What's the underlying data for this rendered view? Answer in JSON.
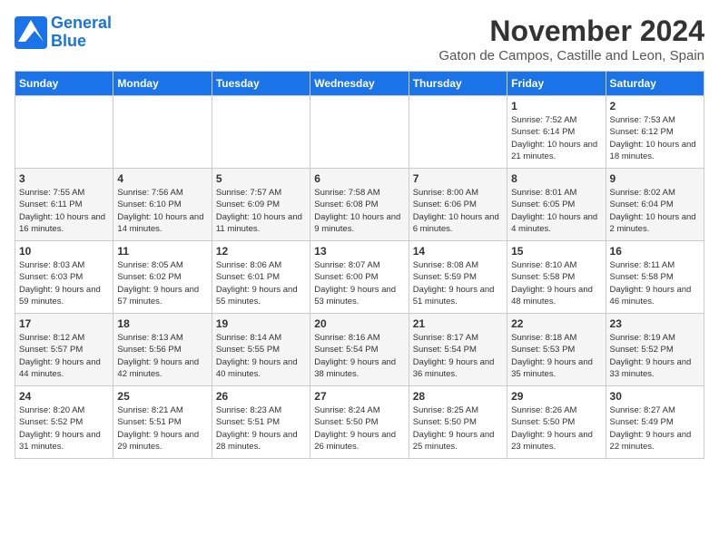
{
  "logo": {
    "line1": "General",
    "line2": "Blue"
  },
  "title": "November 2024",
  "location": "Gaton de Campos, Castille and Leon, Spain",
  "days_of_week": [
    "Sunday",
    "Monday",
    "Tuesday",
    "Wednesday",
    "Thursday",
    "Friday",
    "Saturday"
  ],
  "weeks": [
    [
      {
        "day": "",
        "info": ""
      },
      {
        "day": "",
        "info": ""
      },
      {
        "day": "",
        "info": ""
      },
      {
        "day": "",
        "info": ""
      },
      {
        "day": "",
        "info": ""
      },
      {
        "day": "1",
        "info": "Sunrise: 7:52 AM\nSunset: 6:14 PM\nDaylight: 10 hours and 21 minutes."
      },
      {
        "day": "2",
        "info": "Sunrise: 7:53 AM\nSunset: 6:12 PM\nDaylight: 10 hours and 18 minutes."
      }
    ],
    [
      {
        "day": "3",
        "info": "Sunrise: 7:55 AM\nSunset: 6:11 PM\nDaylight: 10 hours and 16 minutes."
      },
      {
        "day": "4",
        "info": "Sunrise: 7:56 AM\nSunset: 6:10 PM\nDaylight: 10 hours and 14 minutes."
      },
      {
        "day": "5",
        "info": "Sunrise: 7:57 AM\nSunset: 6:09 PM\nDaylight: 10 hours and 11 minutes."
      },
      {
        "day": "6",
        "info": "Sunrise: 7:58 AM\nSunset: 6:08 PM\nDaylight: 10 hours and 9 minutes."
      },
      {
        "day": "7",
        "info": "Sunrise: 8:00 AM\nSunset: 6:06 PM\nDaylight: 10 hours and 6 minutes."
      },
      {
        "day": "8",
        "info": "Sunrise: 8:01 AM\nSunset: 6:05 PM\nDaylight: 10 hours and 4 minutes."
      },
      {
        "day": "9",
        "info": "Sunrise: 8:02 AM\nSunset: 6:04 PM\nDaylight: 10 hours and 2 minutes."
      }
    ],
    [
      {
        "day": "10",
        "info": "Sunrise: 8:03 AM\nSunset: 6:03 PM\nDaylight: 9 hours and 59 minutes."
      },
      {
        "day": "11",
        "info": "Sunrise: 8:05 AM\nSunset: 6:02 PM\nDaylight: 9 hours and 57 minutes."
      },
      {
        "day": "12",
        "info": "Sunrise: 8:06 AM\nSunset: 6:01 PM\nDaylight: 9 hours and 55 minutes."
      },
      {
        "day": "13",
        "info": "Sunrise: 8:07 AM\nSunset: 6:00 PM\nDaylight: 9 hours and 53 minutes."
      },
      {
        "day": "14",
        "info": "Sunrise: 8:08 AM\nSunset: 5:59 PM\nDaylight: 9 hours and 51 minutes."
      },
      {
        "day": "15",
        "info": "Sunrise: 8:10 AM\nSunset: 5:58 PM\nDaylight: 9 hours and 48 minutes."
      },
      {
        "day": "16",
        "info": "Sunrise: 8:11 AM\nSunset: 5:58 PM\nDaylight: 9 hours and 46 minutes."
      }
    ],
    [
      {
        "day": "17",
        "info": "Sunrise: 8:12 AM\nSunset: 5:57 PM\nDaylight: 9 hours and 44 minutes."
      },
      {
        "day": "18",
        "info": "Sunrise: 8:13 AM\nSunset: 5:56 PM\nDaylight: 9 hours and 42 minutes."
      },
      {
        "day": "19",
        "info": "Sunrise: 8:14 AM\nSunset: 5:55 PM\nDaylight: 9 hours and 40 minutes."
      },
      {
        "day": "20",
        "info": "Sunrise: 8:16 AM\nSunset: 5:54 PM\nDaylight: 9 hours and 38 minutes."
      },
      {
        "day": "21",
        "info": "Sunrise: 8:17 AM\nSunset: 5:54 PM\nDaylight: 9 hours and 36 minutes."
      },
      {
        "day": "22",
        "info": "Sunrise: 8:18 AM\nSunset: 5:53 PM\nDaylight: 9 hours and 35 minutes."
      },
      {
        "day": "23",
        "info": "Sunrise: 8:19 AM\nSunset: 5:52 PM\nDaylight: 9 hours and 33 minutes."
      }
    ],
    [
      {
        "day": "24",
        "info": "Sunrise: 8:20 AM\nSunset: 5:52 PM\nDaylight: 9 hours and 31 minutes."
      },
      {
        "day": "25",
        "info": "Sunrise: 8:21 AM\nSunset: 5:51 PM\nDaylight: 9 hours and 29 minutes."
      },
      {
        "day": "26",
        "info": "Sunrise: 8:23 AM\nSunset: 5:51 PM\nDaylight: 9 hours and 28 minutes."
      },
      {
        "day": "27",
        "info": "Sunrise: 8:24 AM\nSunset: 5:50 PM\nDaylight: 9 hours and 26 minutes."
      },
      {
        "day": "28",
        "info": "Sunrise: 8:25 AM\nSunset: 5:50 PM\nDaylight: 9 hours and 25 minutes."
      },
      {
        "day": "29",
        "info": "Sunrise: 8:26 AM\nSunset: 5:50 PM\nDaylight: 9 hours and 23 minutes."
      },
      {
        "day": "30",
        "info": "Sunrise: 8:27 AM\nSunset: 5:49 PM\nDaylight: 9 hours and 22 minutes."
      }
    ]
  ]
}
